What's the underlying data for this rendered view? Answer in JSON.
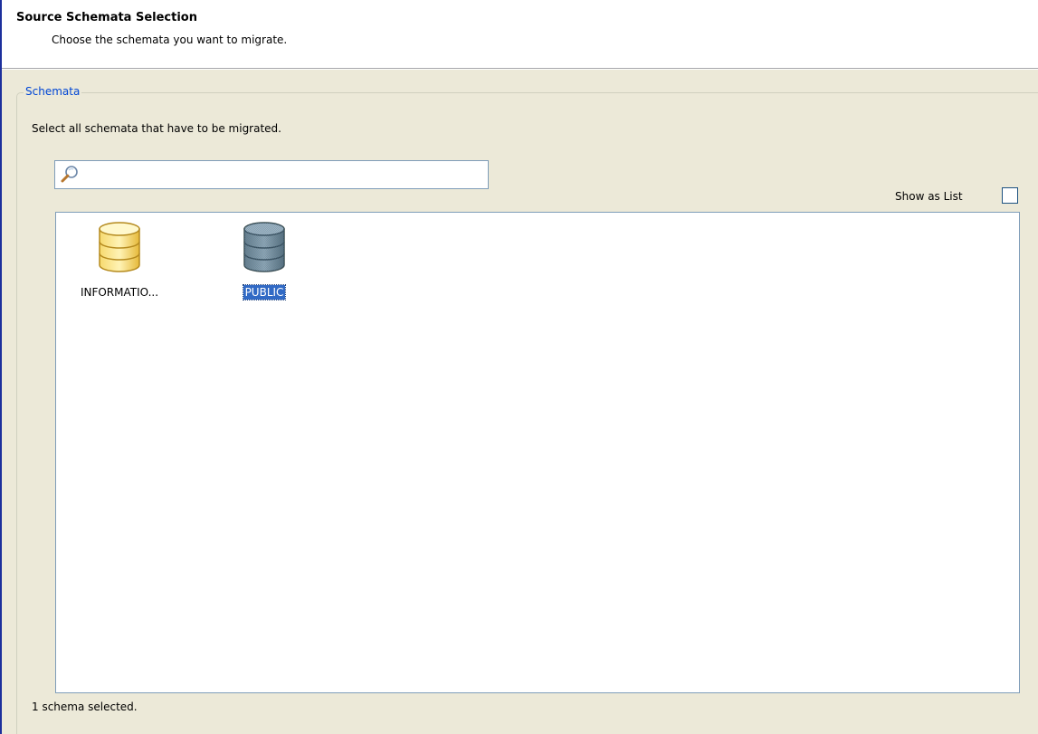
{
  "header": {
    "title": "Source Schemata Selection",
    "subtitle": "Choose the schemata you want to migrate."
  },
  "group": {
    "legend": "Schemata",
    "instructions": "Select all schemata that have to be migrated."
  },
  "search": {
    "value": "",
    "placeholder": ""
  },
  "show_as_list": {
    "label": "Show as List",
    "checked": false
  },
  "schemas": [
    {
      "name": "INFORMATIO...",
      "icon": "database-icon",
      "color": "#f5c84a",
      "selected": false
    },
    {
      "name": "PUBLIC",
      "icon": "database-icon",
      "color": "#7d8f8f",
      "selected": true
    }
  ],
  "status": {
    "text": "1 schema selected."
  },
  "colors": {
    "accent": "#0046d5",
    "selection": "#316ac5",
    "panel_background": "#ece9d8"
  }
}
